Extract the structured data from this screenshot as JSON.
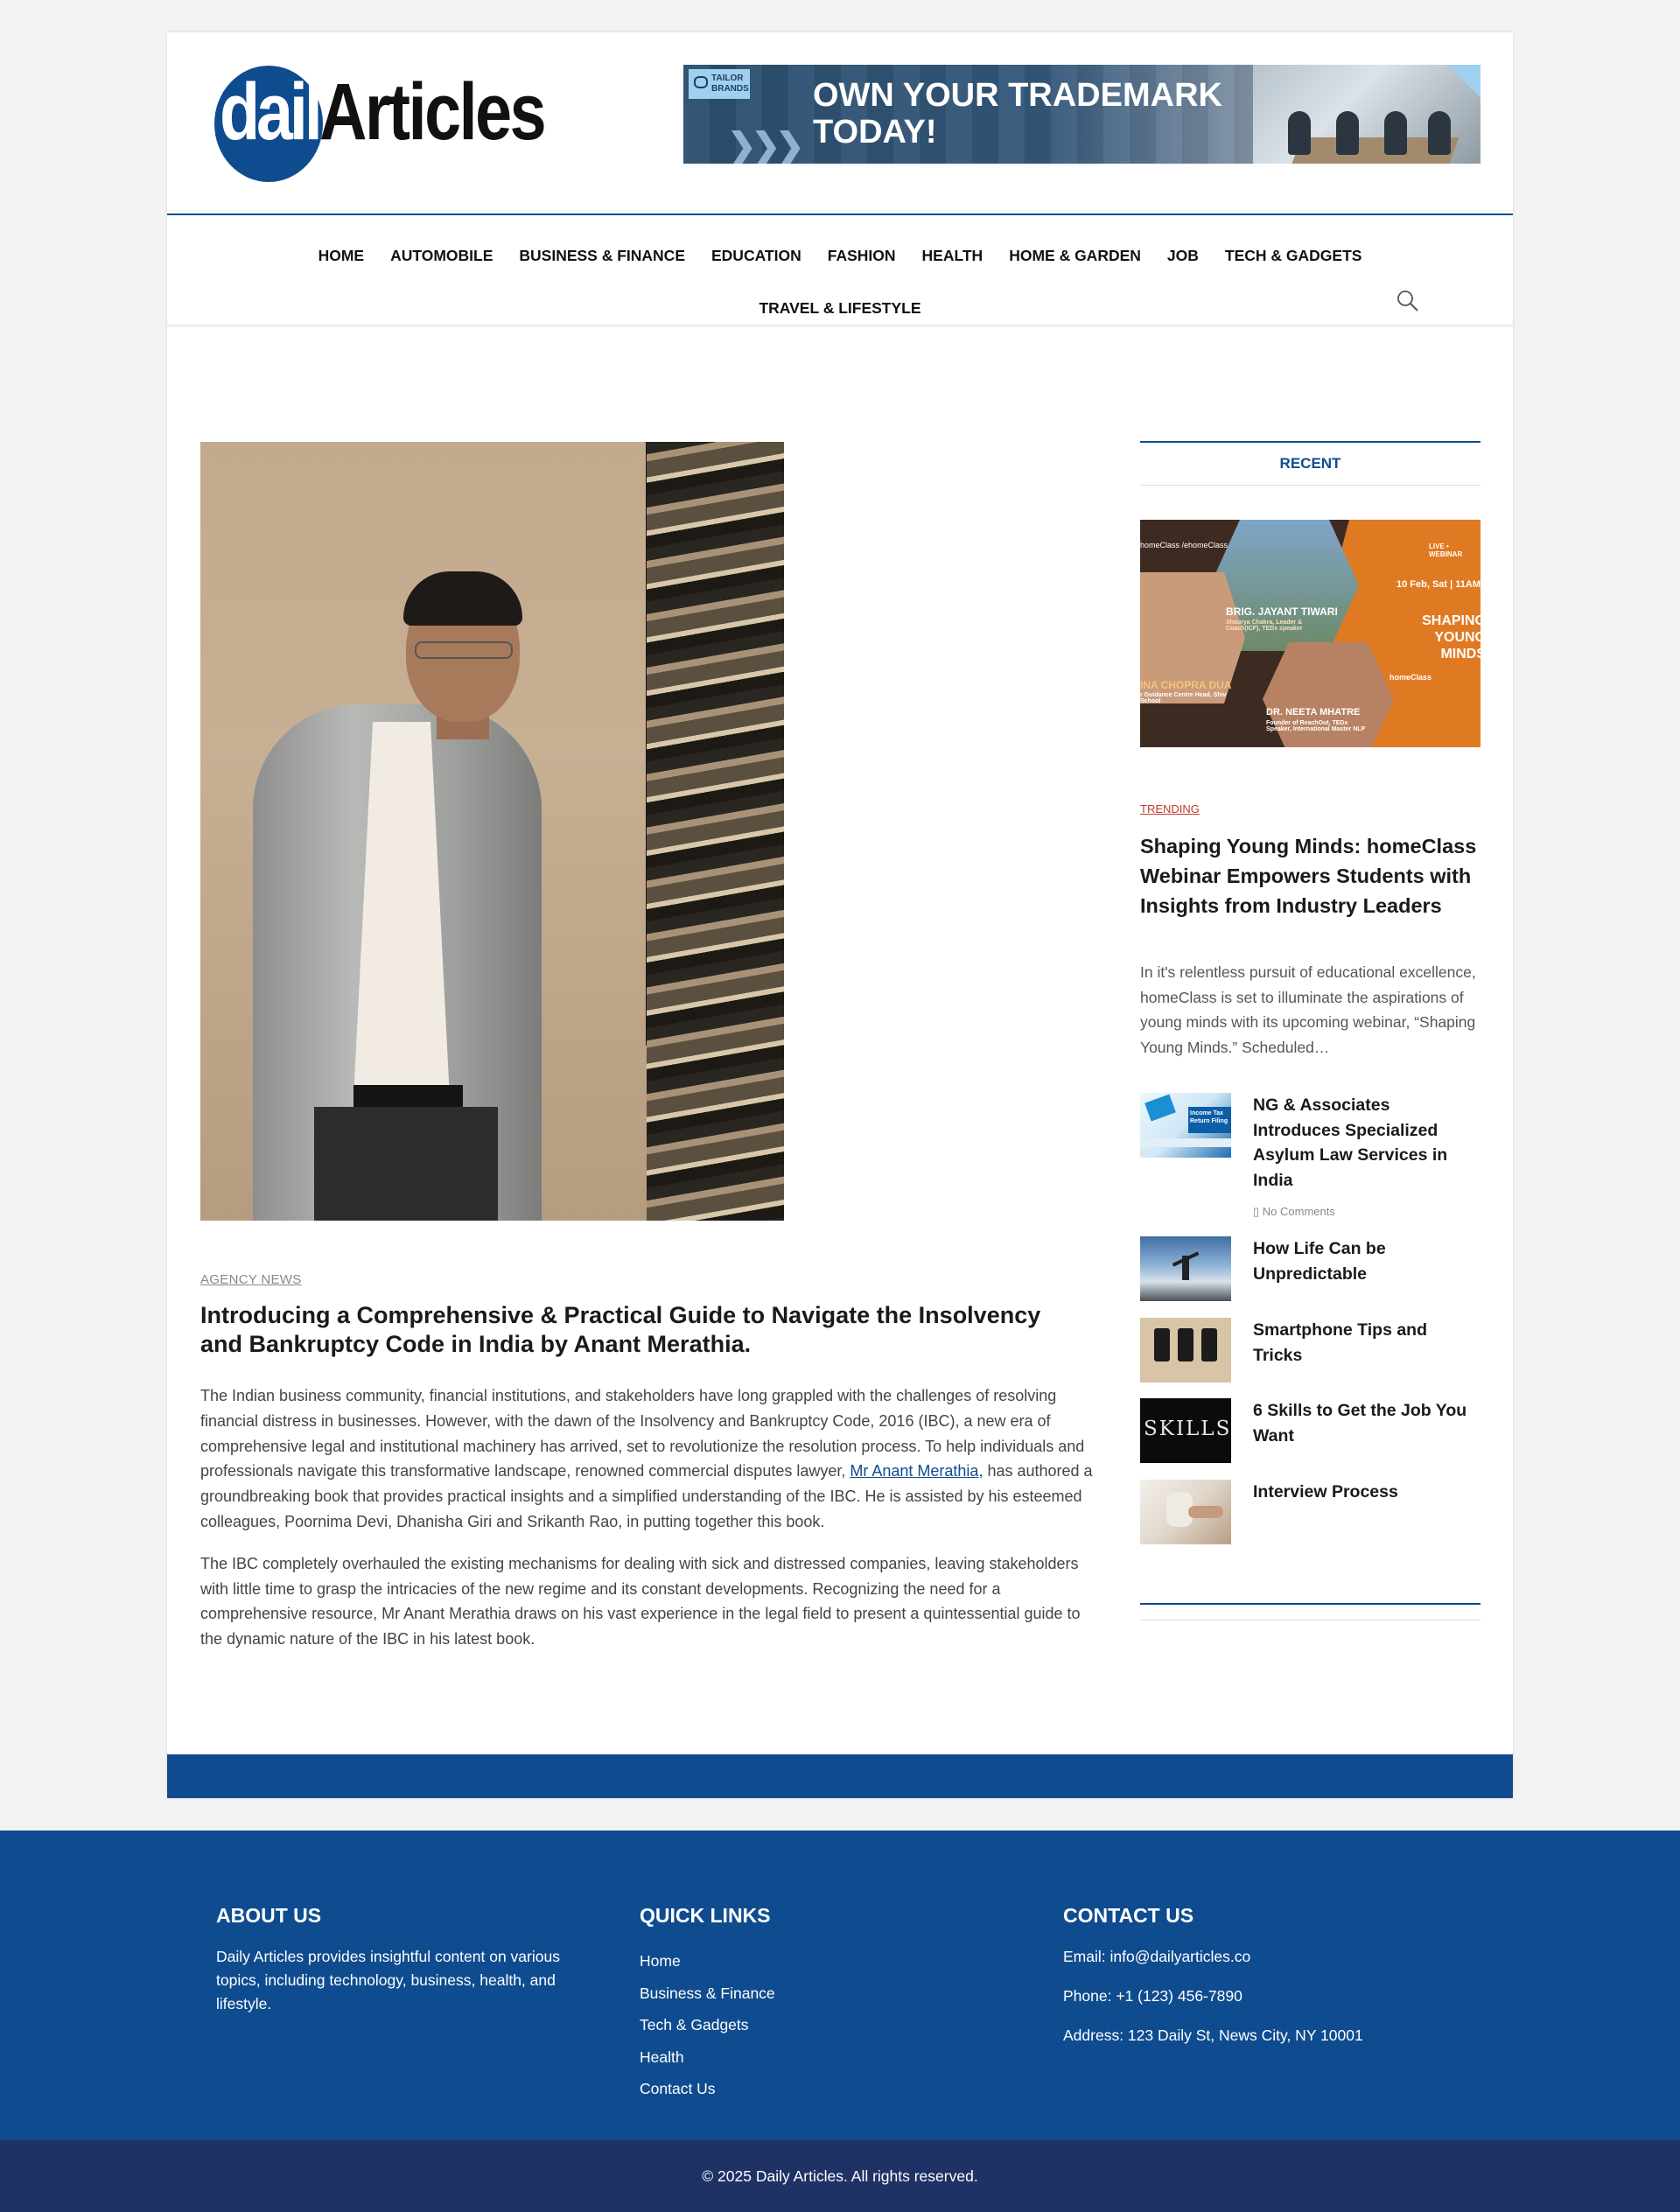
{
  "site": {
    "logo_part1": "daily",
    "logo_part2": "Articles"
  },
  "banner": {
    "brand": "TAILOR BRANDS",
    "headline_line1": "OWN YOUR TRADEMARK",
    "headline_line2": "TODAY!"
  },
  "nav": {
    "row1": [
      "HOME",
      "AUTOMOBILE",
      "BUSINESS & FINANCE",
      "EDUCATION",
      "FASHION",
      "HEALTH",
      "HOME & GARDEN",
      "JOB",
      "TECH & GADGETS"
    ],
    "row2": [
      "TRAVEL & LIFESTYLE"
    ]
  },
  "article": {
    "category": "AGENCY NEWS",
    "title": "Introducing a Comprehensive & Practical Guide to Navigate the Insolvency and Bankruptcy Code in India by Anant Merathia.",
    "p1_before": "The Indian business community, financial institutions, and stakeholders have long grappled with the challenges of resolving financial distress in businesses. However, with the dawn of the Insolvency and Bankruptcy Code, 2016 (IBC), a new era of comprehensive legal and institutional machinery has arrived, set to revolutionize the resolution process. To help individuals and professionals navigate this transformative landscape, renowned commercial disputes lawyer, ",
    "p1_link": "Mr Anant Merathia",
    "p1_after": ", has authored a groundbreaking book that provides practical insights and a simplified understanding of the IBC. He is assisted by his esteemed colleagues, Poornima Devi, Dhanisha Giri and Srikanth Rao, in putting together this book.",
    "p2": "The IBC completely overhauled the existing mechanisms for dealing with sick and distressed companies, leaving stakeholders with little time to grasp the intricacies of the new regime and its constant developments. Recognizing the need for a comprehensive resource, Mr Anant Merathia draws on his vast experience in the legal field to present a quintessential guide to the dynamic nature of the IBC in his latest book."
  },
  "sidebar": {
    "heading": "RECENT",
    "feature": {
      "image_text": {
        "brand": "homeClass /ehomeClass",
        "live": "LIVE • WEBINAR",
        "date": "10 Feb, Sat | 11AM",
        "title": "SHAPING YOUNG MINDS",
        "speaker1": "BRIG. JAYANT TIWARI",
        "speaker1_desc": "Shaurya Chakra, Leader & Coach(ICF), TEDx speaker",
        "speaker2": "INA CHOPRA DUA",
        "speaker2_desc": "r Guidance Centre Head, Shiv School",
        "speaker3": "DR. NEETA MHATRE",
        "speaker3_desc": "Founder of ReachOut, TEDx Speaker, International Master NLP",
        "logo": "homeClass"
      },
      "tag": "TRENDING",
      "title": "Shaping Young Minds: homeClass Webinar Empowers Students with Insights from Industry Leaders",
      "excerpt": "In it's relentless pursuit of educational excellence, homeClass is set to illuminate the aspirations of young minds with its upcoming webinar, “Shaping Young Minds.” Scheduled…"
    },
    "items": [
      {
        "title": "NG & Associates Introduces Specialized Asylum Law Services in India",
        "meta": "No Comments",
        "thumb_text": "Income Tax Return Filing"
      },
      {
        "title": "How Life Can be Unpredictable"
      },
      {
        "title": "Smartphone Tips and Tricks"
      },
      {
        "title": "6 Skills to Get the Job You Want",
        "thumb_text": "SKILLS"
      },
      {
        "title": "Interview Process"
      }
    ]
  },
  "footer": {
    "about_heading": "ABOUT US",
    "about_text": "Daily Articles provides insightful content on various topics, including technology, business, health, and lifestyle.",
    "links_heading": "QUICK LINKS",
    "links": [
      "Home",
      "Business & Finance",
      "Tech & Gadgets",
      "Health",
      "Contact Us"
    ],
    "contact_heading": "CONTACT US",
    "email": "Email: info@dailyarticles.co",
    "phone": "Phone: +1 (123) 456-7890",
    "address": "Address: 123 Daily St, News City, NY 10001",
    "copyright": "© 2025 Daily Articles. All rights reserved."
  }
}
